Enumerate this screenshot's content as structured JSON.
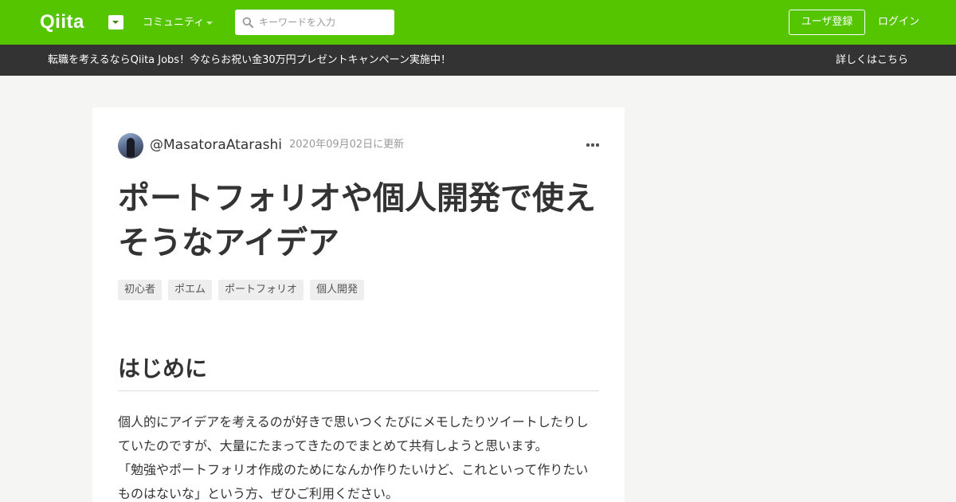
{
  "header": {
    "logo_text": "Qiita",
    "community_label": "コミュニティ",
    "search_placeholder": "キーワードを入力",
    "signup_label": "ユーザ登録",
    "login_label": "ログイン",
    "brand_color": "#55c500"
  },
  "promo": {
    "text": "転職を考えるならQiita Jobs！今ならお祝い金30万円プレゼントキャンペーン実施中！",
    "link_label": "詳しくはこちら"
  },
  "article": {
    "username": "@MasatoraAtarashi",
    "updated": "2020年09月02日に更新",
    "title": "ポートフォリオや個人開発で使えそうなアイデア",
    "tags": [
      "初心者",
      "ポエム",
      "ポートフォリオ",
      "個人開発"
    ],
    "section_heading": "はじめに",
    "paragraphs": [
      "個人的にアイデアを考えるのが好きで思いつくたびにメモしたりツイートしたりしていたのですが、大量にたまってきたのでまとめて共有しようと思います。",
      "「勉強やポートフォリオ作成のためになんか作りたいけど、これといって作りたいものはないな」という方、ぜひご利用ください。"
    ]
  }
}
